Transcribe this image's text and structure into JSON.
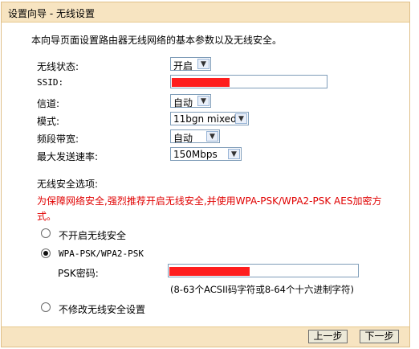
{
  "title": "设置向导 - 无线设置",
  "intro": "本向导页面设置路由器无线网络的基本参数以及无线安全。",
  "form": {
    "wireless_status": {
      "label": "无线状态:",
      "value": "开启"
    },
    "ssid": {
      "label": "SSID:",
      "value": "[redacted]"
    },
    "channel": {
      "label": "信道:",
      "value": "自动"
    },
    "mode": {
      "label": "模式:",
      "value": "11bgn mixed"
    },
    "bandwidth": {
      "label": "频段带宽:",
      "value": "自动"
    },
    "max_rate": {
      "label": "最大发送速率:",
      "value": "150Mbps"
    }
  },
  "security": {
    "heading": "无线安全选项:",
    "warning_line1": "为保障网络安全,强烈推荐开启无线安全,并使用WPA-PSK/WPA2-PSK AES加密方",
    "warning_line2": "式。",
    "option_off": "不开启无线安全",
    "option_wpa": "WPA-PSK/WPA2-PSK",
    "psk_label": "PSK密码:",
    "psk_value": "[redacted]",
    "psk_hint": "(8-63个ACSII码字符或8-64个十六进制字符)",
    "option_keep": "不修改无线安全设置",
    "selected": "WPA-PSK/WPA2-PSK"
  },
  "buttons": {
    "prev": "上一步",
    "next": "下一步"
  },
  "colors": {
    "title_bg": "#f7e4c1",
    "warning": "#e00000",
    "redaction": "#ff1e1e"
  }
}
